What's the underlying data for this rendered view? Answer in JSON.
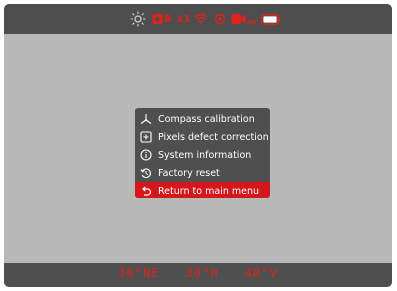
{
  "status_bar": {
    "icons": [
      {
        "name": "brightness-icon"
      },
      {
        "name": "battery-rec-icon"
      },
      {
        "name": "wifi-icon"
      },
      {
        "name": "eye-icon"
      },
      {
        "name": "recording-icon"
      },
      {
        "name": "battery-icon"
      }
    ],
    "zoom_label": "x1",
    "display_mode_label": "B",
    "rec_sub_label": "REC",
    "accent_color": "#e2211c"
  },
  "menu": {
    "items": [
      {
        "label": "Compass calibration",
        "icon": "compass-icon",
        "selected": false
      },
      {
        "label": "Pixels defect correction",
        "icon": "pixel-plus-icon",
        "selected": false
      },
      {
        "label": "System information",
        "icon": "info-icon",
        "selected": false
      },
      {
        "label": "Factory reset",
        "icon": "reset-icon",
        "selected": false
      },
      {
        "label": "Return to main menu",
        "icon": "return-icon",
        "selected": true
      }
    ],
    "selected_color": "#d4171b"
  },
  "readouts": {
    "heading": "30°NE",
    "horizontal": "30°H",
    "vertical": "40°V"
  }
}
